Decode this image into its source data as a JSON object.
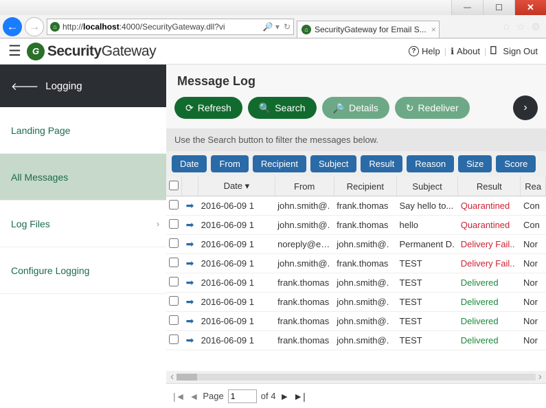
{
  "browser": {
    "url_prefix": "http://",
    "url_host": "localhost",
    "url_rest": ":4000/SecurityGateway.dll?vi",
    "tab_title": "SecurityGateway for Email S..."
  },
  "brand": {
    "bold": "Security",
    "thin": "Gateway"
  },
  "top_links": {
    "help": "Help",
    "about": "About",
    "sign_out": "Sign Out"
  },
  "sidebar": {
    "header": "Logging",
    "items": [
      {
        "label": "Landing Page"
      },
      {
        "label": "All Messages"
      },
      {
        "label": "Log Files"
      },
      {
        "label": "Configure Logging"
      }
    ]
  },
  "page": {
    "title": "Message Log",
    "hint": "Use the Search button to filter the messages below."
  },
  "toolbar": {
    "refresh": "Refresh",
    "search": "Search",
    "details": "Details",
    "redeliver": "Redeliver"
  },
  "filters": [
    "Date",
    "From",
    "Recipient",
    "Subject",
    "Result",
    "Reason",
    "Size",
    "Score"
  ],
  "columns": {
    "date": "Date ▾",
    "from": "From",
    "recipient": "Recipient",
    "subject": "Subject",
    "result": "Result",
    "reason": "Rea"
  },
  "rows": [
    {
      "date": "2016-06-09 1",
      "from": "john.smith@.",
      "rcpt": "frank.thomas",
      "subj": "Say hello to...",
      "result": "Quarantined",
      "reason": "Con"
    },
    {
      "date": "2016-06-09 1",
      "from": "john.smith@.",
      "rcpt": "frank.thomas",
      "subj": "hello",
      "result": "Quarantined",
      "reason": "Con"
    },
    {
      "date": "2016-06-09 1",
      "from": "noreply@exa.",
      "rcpt": "john.smith@.",
      "subj": "Permanent D.",
      "result": "Delivery Fail..",
      "reason": "Nor"
    },
    {
      "date": "2016-06-09 1",
      "from": "john.smith@.",
      "rcpt": "frank.thomas",
      "subj": "TEST",
      "result": "Delivery Fail..",
      "reason": "Nor"
    },
    {
      "date": "2016-06-09 1",
      "from": "frank.thomas",
      "rcpt": "john.smith@.",
      "subj": "TEST",
      "result": "Delivered",
      "reason": "Nor"
    },
    {
      "date": "2016-06-09 1",
      "from": "frank.thomas",
      "rcpt": "john.smith@.",
      "subj": "TEST",
      "result": "Delivered",
      "reason": "Nor"
    },
    {
      "date": "2016-06-09 1",
      "from": "frank.thomas",
      "rcpt": "john.smith@.",
      "subj": "TEST",
      "result": "Delivered",
      "reason": "Nor"
    },
    {
      "date": "2016-06-09 1",
      "from": "frank.thomas",
      "rcpt": "john.smith@.",
      "subj": "TEST",
      "result": "Delivered",
      "reason": "Nor"
    }
  ],
  "paging": {
    "label": "Page",
    "current": "1",
    "total_label": "of 4"
  }
}
